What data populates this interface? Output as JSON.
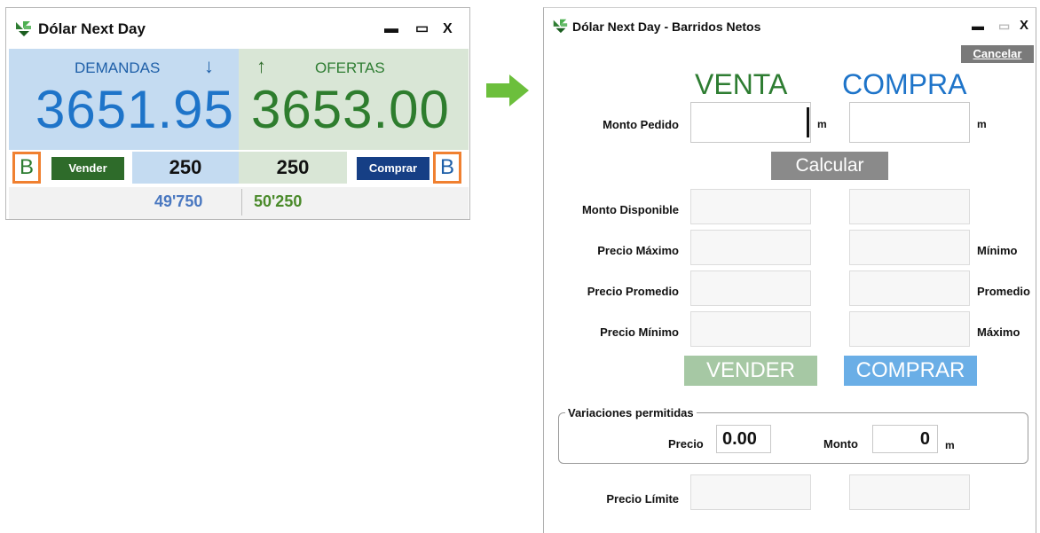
{
  "left_window": {
    "title": "Dólar Next Day",
    "controls": {
      "minimize": "▬",
      "maximize": "▭",
      "close": "X"
    },
    "demandas_label": "DEMANDAS",
    "demandas_arrow": "↓",
    "ofertas_arrow": "↑",
    "ofertas_label": "OFERTAS",
    "bid_price": "3651.95",
    "ask_price": "3653.00",
    "b_left": "B",
    "vender_label": "Vender",
    "bid_qty": "250",
    "ask_qty": "250",
    "comprar_label": "Comprar",
    "b_right": "B",
    "bid_total": "49'750",
    "ask_total": "50'250"
  },
  "right_window": {
    "title": "Dólar Next Day - Barridos Netos",
    "controls": {
      "minimize": "▬",
      "maximize": "▭",
      "close": "X"
    },
    "cancel_label": "Cancelar",
    "venta_header": "VENTA",
    "compra_header": "COMPRA",
    "monto_pedido_label": "Monto Pedido",
    "unit_m": "m",
    "calcular_label": "Calcular",
    "monto_disponible_label": "Monto Disponible",
    "precio_maximo_label": "Precio Máximo",
    "minimo_label": "Mínimo",
    "precio_promedio_label": "Precio Promedio",
    "promedio_label": "Promedio",
    "precio_minimo_label": "Precio Mínimo",
    "maximo_label": "Máximo",
    "vender_label": "VENDER",
    "comprar_label": "COMPRAR",
    "variaciones_title": "Variaciones permitidas",
    "precio_label": "Precio",
    "precio_value": "0.00",
    "monto_label": "Monto",
    "monto_value": "0",
    "precio_limite_label": "Precio Límite"
  },
  "colors": {
    "bid_blue": "#1e74c9",
    "ask_green": "#2e7d2e",
    "highlight_orange": "#f08030",
    "arrow_green": "#6cbf3c"
  }
}
